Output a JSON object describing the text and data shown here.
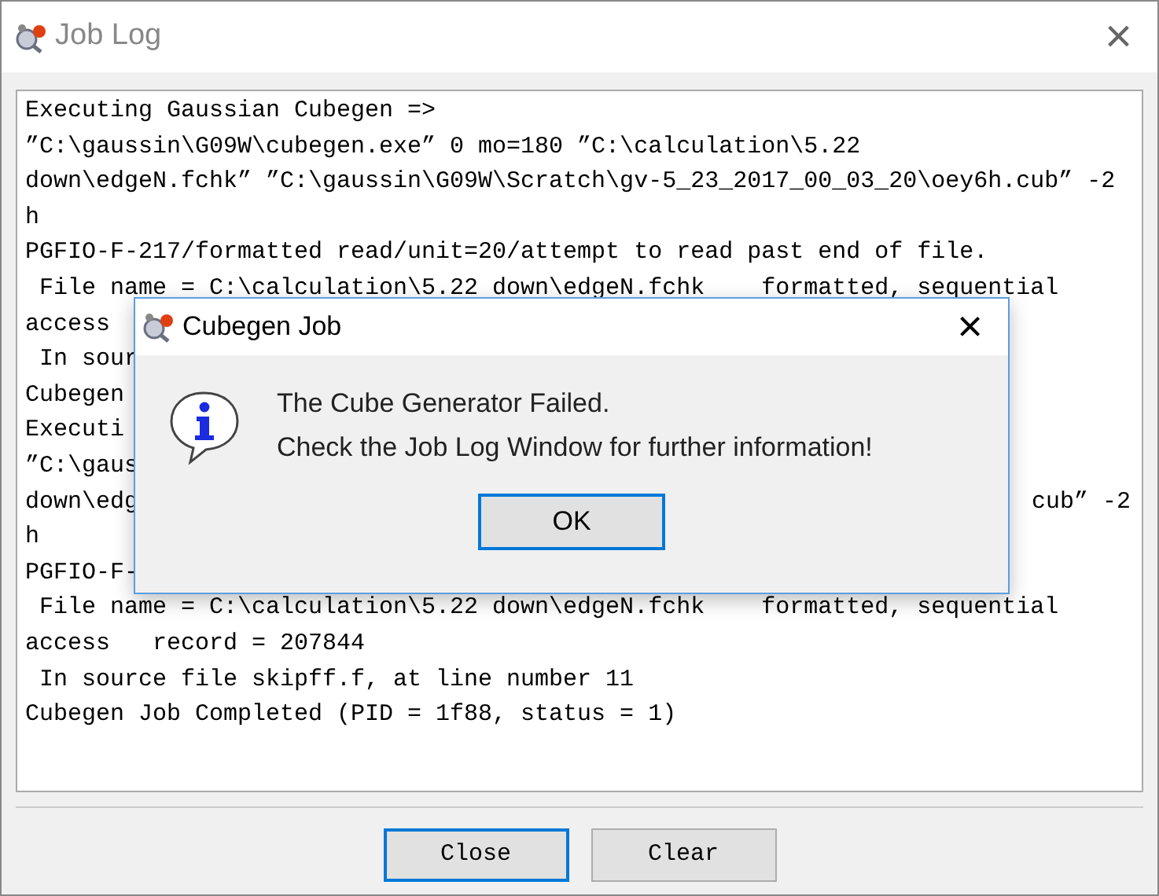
{
  "window": {
    "title": "Job Log",
    "close": "×"
  },
  "log": [
    {
      "text": "Executing Gaussian Cubegen =>"
    },
    {
      "text": "”C:\\gaussin\\G09W\\cubegen.exe” 0 mo=180 ”C:\\calculation\\5.22"
    },
    {
      "text": "down\\edgeN.fchk” ”C:\\gaussin\\G09W\\Scratch\\gv-5_23_2017_00_03_20\\oey6h.cub” -2"
    },
    {
      "text": "h"
    },
    {
      "text": "PGFIO-F-217/formatted read/unit=20/attempt to read past end of file."
    },
    {
      "text": " File name = C:\\calculation\\5.22 down\\edgeN.fchk    formatted, sequential"
    },
    {
      "text": "access"
    },
    {
      "text": " In sour"
    },
    {
      "text": "Cubegen"
    },
    {
      "text": "Executi"
    },
    {
      "text": "”C:\\gaus"
    },
    {
      "text": "down\\edg",
      "right": "cub” -2"
    },
    {
      "text": "h"
    },
    {
      "text": "PGFIO-F-"
    },
    {
      "text": " File name = C:\\calculation\\5.22 down\\edgeN.fchk    formatted, sequential"
    },
    {
      "text": "access   record = 207844"
    },
    {
      "text": " In source file skipff.f, at line number 11"
    },
    {
      "text": "Cubegen Job Completed (PID = 1f88, status = 1)"
    }
  ],
  "buttons": [
    {
      "label": "Close",
      "selected": true
    },
    {
      "label": "Clear",
      "selected": false
    }
  ],
  "dialog": {
    "title": "Cubegen Job",
    "close": "×",
    "message": [
      "The Cube Generator Failed.",
      "Check the Job Log Window for further information!"
    ],
    "ok": "OK"
  }
}
